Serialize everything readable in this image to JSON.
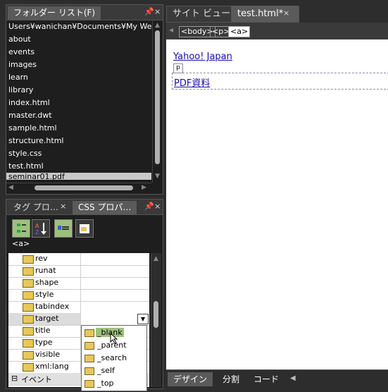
{
  "folder_panel": {
    "title": "フォルダー リスト(F)",
    "pin": "📌",
    "close": "×",
    "path": "Users¥wanichan¥Documents¥My Web S",
    "items": [
      "about",
      "events",
      "images",
      "learn",
      "library",
      "index.html",
      "master.dwt",
      "sample.html",
      "structure.html",
      "style.css",
      "test.html",
      "seminar01.pdf"
    ]
  },
  "tag_panel": {
    "tab1": "タグ プロ…",
    "tab1_close": "×",
    "tab2": "CSS プロパ…",
    "pin": "📌",
    "close": "×",
    "current_tag": "<a>",
    "properties": [
      {
        "name": "rev",
        "value": ""
      },
      {
        "name": "runat",
        "value": ""
      },
      {
        "name": "shape",
        "value": ""
      },
      {
        "name": "style",
        "value": ""
      },
      {
        "name": "tabindex",
        "value": ""
      },
      {
        "name": "target",
        "value": ""
      },
      {
        "name": "title",
        "value": ""
      },
      {
        "name": "type",
        "value": ""
      },
      {
        "name": "visible",
        "value": ""
      },
      {
        "name": "xml:lang",
        "value": ""
      }
    ],
    "section": "イベント",
    "section_toggle": "⊟",
    "target_options": [
      "_blank",
      "_parent",
      "_search",
      "_self",
      "_top"
    ],
    "highlighted_option": "_blank"
  },
  "document": {
    "tabs": [
      {
        "label": "サイト ビュー",
        "active": false
      },
      {
        "label": "test.html*",
        "active": true
      }
    ],
    "tab_close": "×",
    "breadcrumbs": [
      "<body>",
      "<p>",
      "<a>"
    ],
    "links": [
      "Yahoo! Japan",
      "PDF資料"
    ],
    "p_marker": "p",
    "view_tabs": [
      "デザイン",
      "分割",
      "コード"
    ]
  }
}
